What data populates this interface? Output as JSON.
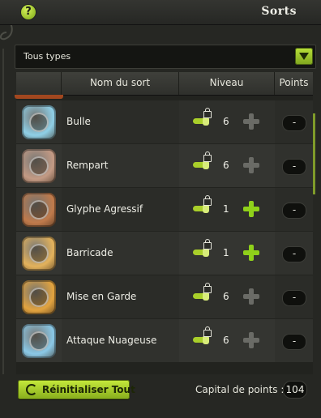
{
  "window": {
    "title": "Sorts",
    "help_label": "?"
  },
  "filter": {
    "value": "Tous types"
  },
  "columns": {
    "name": "Nom du sort",
    "level": "Niveau",
    "points": "Points"
  },
  "spells": [
    {
      "name": "Bulle",
      "level": "6",
      "points": "-",
      "upgradable": false,
      "icon": "bubble-figure-icon",
      "color": "#8fcfe6"
    },
    {
      "name": "Rempart",
      "level": "6",
      "points": "-",
      "upgradable": false,
      "icon": "rampart-shield-icon",
      "color": "#c39a84"
    },
    {
      "name": "Glyphe Agressif",
      "level": "1",
      "points": "-",
      "upgradable": true,
      "icon": "aggressive-glyph-icon",
      "color": "#c07a4b"
    },
    {
      "name": "Barricade",
      "level": "1",
      "points": "-",
      "upgradable": true,
      "icon": "barricade-icon",
      "color": "#e3b25c"
    },
    {
      "name": "Mise en Garde",
      "level": "6",
      "points": "-",
      "upgradable": false,
      "icon": "guard-figure-icon",
      "color": "#e2a33f"
    },
    {
      "name": "Attaque Nuageuse",
      "level": "6",
      "points": "-",
      "upgradable": false,
      "icon": "cloud-attack-icon",
      "color": "#8ac8e6"
    }
  ],
  "footer": {
    "reset_label": "Réinitialiser Tout",
    "capital_label": "Capital de points :",
    "capital_value": "104"
  },
  "colors": {
    "accent": "#a9cf2a",
    "plus_enabled": "#8fd11a",
    "plus_disabled": "#6a6b66"
  }
}
